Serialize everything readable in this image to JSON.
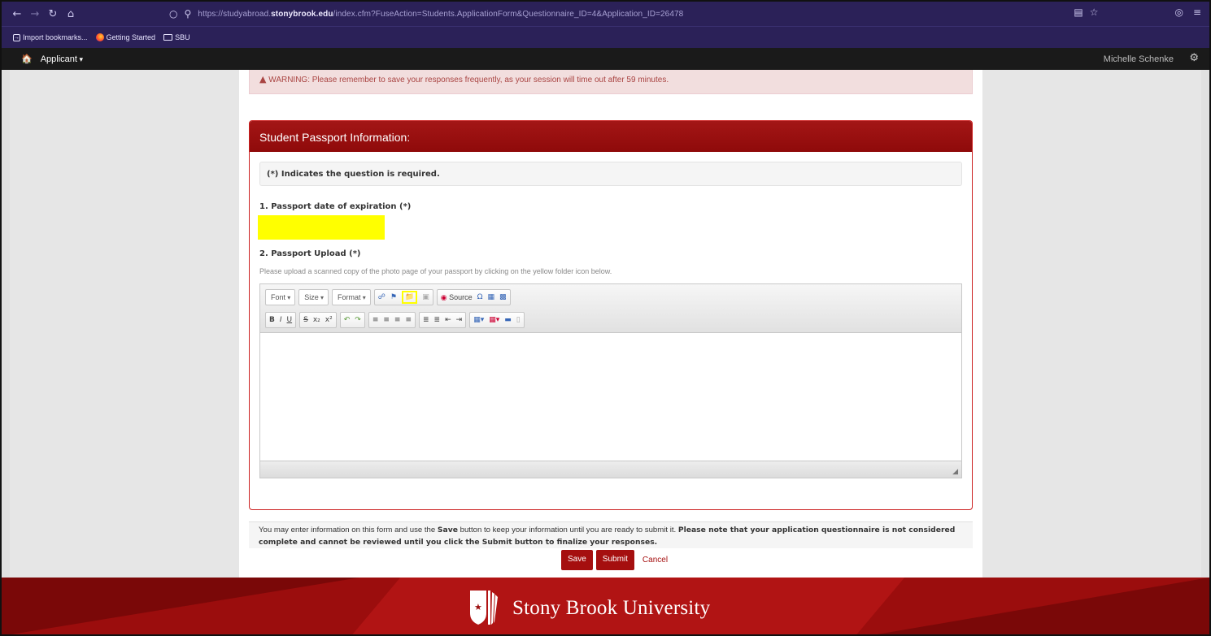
{
  "browser": {
    "url_prefix": "https://studyabroad.",
    "url_domain": "stonybrook.edu",
    "url_path": "/index.cfm?FuseAction=Students.ApplicationForm&Questionnaire_ID=4&Application_ID=26478",
    "bookmarks": [
      "Import bookmarks...",
      "Getting Started",
      "SBU"
    ]
  },
  "appnav": {
    "menu_label": "Applicant",
    "user_name": "Michelle Schenke"
  },
  "warning": {
    "text": "WARNING: Please remember to save your responses frequently, as your session will time out after 59 minutes."
  },
  "panel": {
    "title": "Student Passport Information:",
    "required_note": "(*) Indicates the question is required.",
    "q1_label": "1. Passport date of expiration  (*)",
    "q1_value": "",
    "q2_label": "2. Passport Upload  (*)",
    "q2_help": "Please upload a scanned copy of the photo page of your passport by clicking on the yellow folder icon below."
  },
  "editor": {
    "font_label": "Font",
    "size_label": "Size",
    "format_label": "Format",
    "source_label": "Source"
  },
  "notice": {
    "part1": "You may enter information on this form and use the ",
    "save_word": "Save",
    "part2": " button to keep your information until you are ready to submit it. ",
    "bold_part": "Please note that your application questionnaire is not considered complete and cannot be reviewed until you click the Submit button to finalize your responses."
  },
  "actions": {
    "save_label": "Save",
    "submit_label": "Submit",
    "cancel_label": "Cancel"
  },
  "footer": {
    "university_name": "Stony Brook University"
  }
}
